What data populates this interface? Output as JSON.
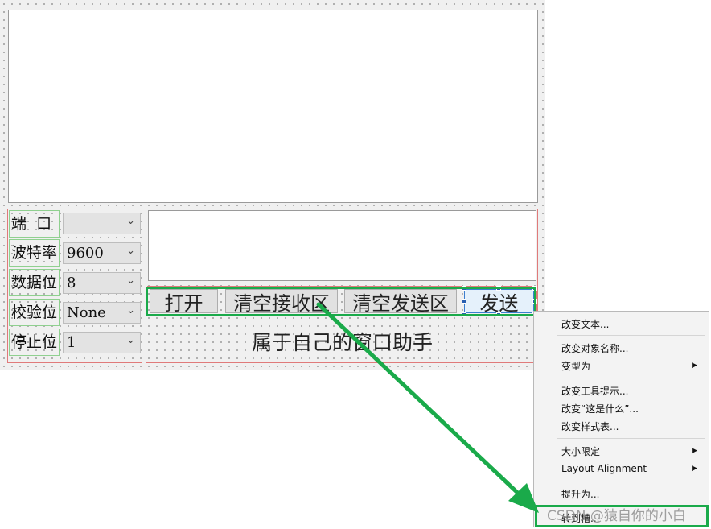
{
  "settings": {
    "port_label": "端  口",
    "baud_label": "波特率",
    "data_bits_label": "数据位",
    "parity_label": "校验位",
    "stop_bits_label": "停止位",
    "port_value": "",
    "baud_value": "9600",
    "data_bits_value": "8",
    "parity_value": "None",
    "stop_bits_value": "1"
  },
  "buttons": {
    "open": "打开",
    "clear_receive": "清空接收区",
    "clear_send": "清空发送区",
    "send": "发送"
  },
  "title_label": "属于自己的窗口助手",
  "context_menu": {
    "items": [
      "改变文本...",
      "改变对象名称...",
      "变型为",
      "改变工具提示...",
      "改变“这是什么”...",
      "改变样式表...",
      "大小限定",
      "Layout Alignment",
      "提升为...",
      "转到槽..."
    ]
  },
  "watermark": "CSDN @猿自你的小白",
  "colors": {
    "accent_green": "#1aaa4a",
    "layout_red": "#e07a7a",
    "selection_blue": "#2a5fb0"
  }
}
